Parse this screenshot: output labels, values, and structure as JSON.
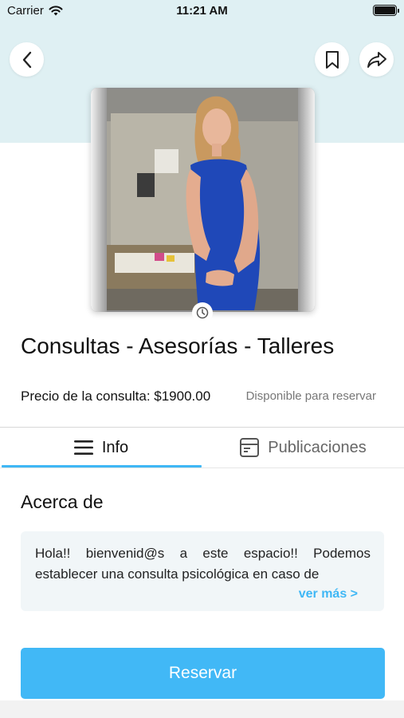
{
  "status_bar": {
    "carrier": "Carrier",
    "time": "11:21 AM"
  },
  "header": {
    "back_icon": "chevron-left-icon",
    "bookmark_icon": "bookmark-icon",
    "share_icon": "share-icon",
    "background_color": "#dff0f3"
  },
  "profile": {
    "photo_alt": "Foto de perfil",
    "title": "Consultas - Asesorías - Talleres",
    "price_label": "Precio de la consulta: $1900.00",
    "availability": "Disponible para reservar"
  },
  "tabs": [
    {
      "label": "Info",
      "icon": "menu-lines-icon",
      "active": true
    },
    {
      "label": "Publicaciones",
      "icon": "calendar-icon",
      "active": false
    }
  ],
  "about": {
    "title": "Acerca de",
    "text": "Hola!! bienvenid@s a este espacio!! Podemos establecer una consulta psicológica en caso de",
    "see_more": "ver más >"
  },
  "actions": {
    "reserve_label": "Reservar"
  },
  "colors": {
    "accent": "#41b8f6",
    "link": "#3fb7f5"
  }
}
